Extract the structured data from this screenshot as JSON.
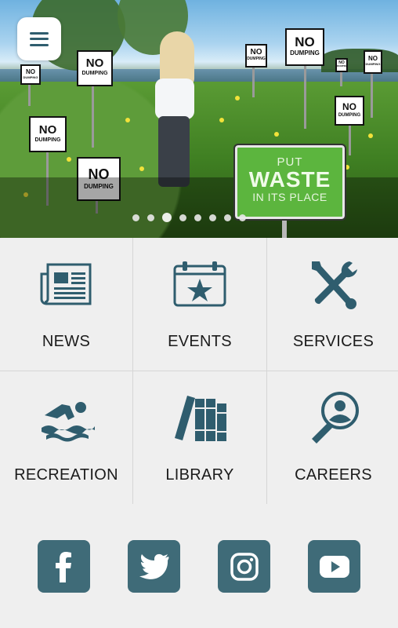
{
  "hero": {
    "signs": [
      {
        "big": "NO",
        "small": "DUMPING"
      },
      {
        "big": "NO",
        "small": "DUMPING"
      },
      {
        "big": "NO",
        "small": "DUMPING"
      },
      {
        "big": "NO",
        "small": "DUMPING"
      },
      {
        "big": "NO",
        "small": "DUMPING"
      },
      {
        "big": "NO",
        "small": "DUMPING"
      },
      {
        "big": "NO",
        "small": "DUMPING"
      },
      {
        "big": "NO",
        "small": "DUMPING"
      },
      {
        "big": "NO",
        "small": "DUMPING"
      }
    ],
    "waste_sign": {
      "line1": "PUT",
      "line2": "WASTE",
      "line3": "IN ITS PLACE"
    },
    "carousel": {
      "slide_count": 8,
      "active_index": 2
    }
  },
  "nav": {
    "tiles": [
      {
        "label": "NEWS",
        "icon": "newspaper-icon"
      },
      {
        "label": "EVENTS",
        "icon": "calendar-star-icon"
      },
      {
        "label": "SERVICES",
        "icon": "wrench-screwdriver-icon"
      },
      {
        "label": "RECREATION",
        "icon": "swimmer-icon"
      },
      {
        "label": "LIBRARY",
        "icon": "books-icon"
      },
      {
        "label": "CAREERS",
        "icon": "search-person-icon"
      }
    ]
  },
  "social": {
    "links": [
      {
        "network": "facebook",
        "icon": "facebook-icon"
      },
      {
        "network": "twitter",
        "icon": "twitter-icon"
      },
      {
        "network": "instagram",
        "icon": "instagram-icon"
      },
      {
        "network": "youtube",
        "icon": "youtube-icon"
      }
    ]
  },
  "colors": {
    "accent": "#3f6b78",
    "icon": "#2f5d6e",
    "tile_bg": "#efefef",
    "waste_green": "#5cb53e"
  }
}
